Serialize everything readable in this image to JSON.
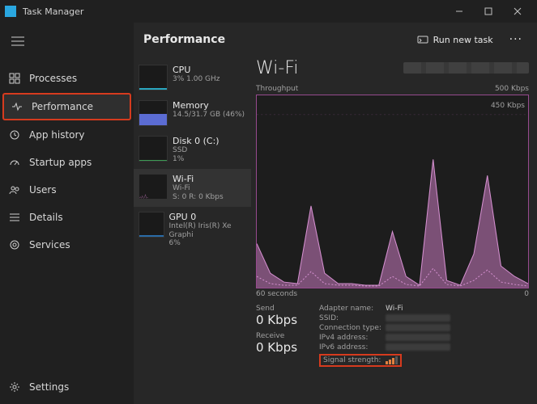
{
  "window": {
    "title": "Task Manager"
  },
  "nav": {
    "items": [
      {
        "label": "Processes"
      },
      {
        "label": "Performance"
      },
      {
        "label": "App history"
      },
      {
        "label": "Startup apps"
      },
      {
        "label": "Users"
      },
      {
        "label": "Details"
      },
      {
        "label": "Services"
      }
    ],
    "settings": "Settings"
  },
  "header": {
    "page_title": "Performance",
    "run_task": "Run new task"
  },
  "perf_list": {
    "cpu": {
      "name": "CPU",
      "sub": "3%  1.00 GHz"
    },
    "mem": {
      "name": "Memory",
      "sub": "14.5/31.7 GB (46%)"
    },
    "disk": {
      "name": "Disk 0 (C:)",
      "sub1": "SSD",
      "sub2": "1%"
    },
    "wifi": {
      "name": "Wi-Fi",
      "sub1": "Wi-Fi",
      "sub2": "S: 0 R: 0 Kbps"
    },
    "gpu": {
      "name": "GPU 0",
      "sub1": "Intel(R) Iris(R) Xe Graphi",
      "sub2": "6%"
    }
  },
  "detail": {
    "title": "Wi-Fi",
    "throughput_label": "Throughput",
    "y_max": "500 Kbps",
    "y_mid": "450 Kbps",
    "x_left": "60 seconds",
    "x_right": "0",
    "send_label": "Send",
    "send_value": "0 Kbps",
    "recv_label": "Receive",
    "recv_value": "0 Kbps",
    "info": {
      "adapter_name_label": "Adapter name:",
      "adapter_name_value": "Wi-Fi",
      "ssid_label": "SSID:",
      "conn_type_label": "Connection type:",
      "ipv4_label": "IPv4 address:",
      "ipv6_label": "IPv6 address:",
      "signal_label": "Signal strength:"
    }
  },
  "chart_data": {
    "type": "area",
    "title": "Wi-Fi Throughput",
    "xlabel": "seconds",
    "ylabel": "Kbps",
    "x_range": [
      60,
      0
    ],
    "ylim": [
      0,
      500
    ],
    "x": [
      60,
      57,
      54,
      51,
      48,
      45,
      42,
      39,
      36,
      33,
      30,
      27,
      24,
      21,
      18,
      15,
      12,
      9,
      6,
      3,
      0
    ],
    "series": [
      {
        "name": "Receive",
        "values": [
          120,
          40,
          15,
          10,
          220,
          40,
          10,
          10,
          5,
          5,
          150,
          30,
          5,
          350,
          20,
          5,
          90,
          300,
          60,
          30,
          10
        ]
      },
      {
        "name": "Send",
        "values": [
          30,
          10,
          5,
          5,
          40,
          10,
          5,
          5,
          3,
          3,
          30,
          8,
          3,
          50,
          8,
          3,
          20,
          45,
          15,
          8,
          3
        ]
      }
    ]
  }
}
